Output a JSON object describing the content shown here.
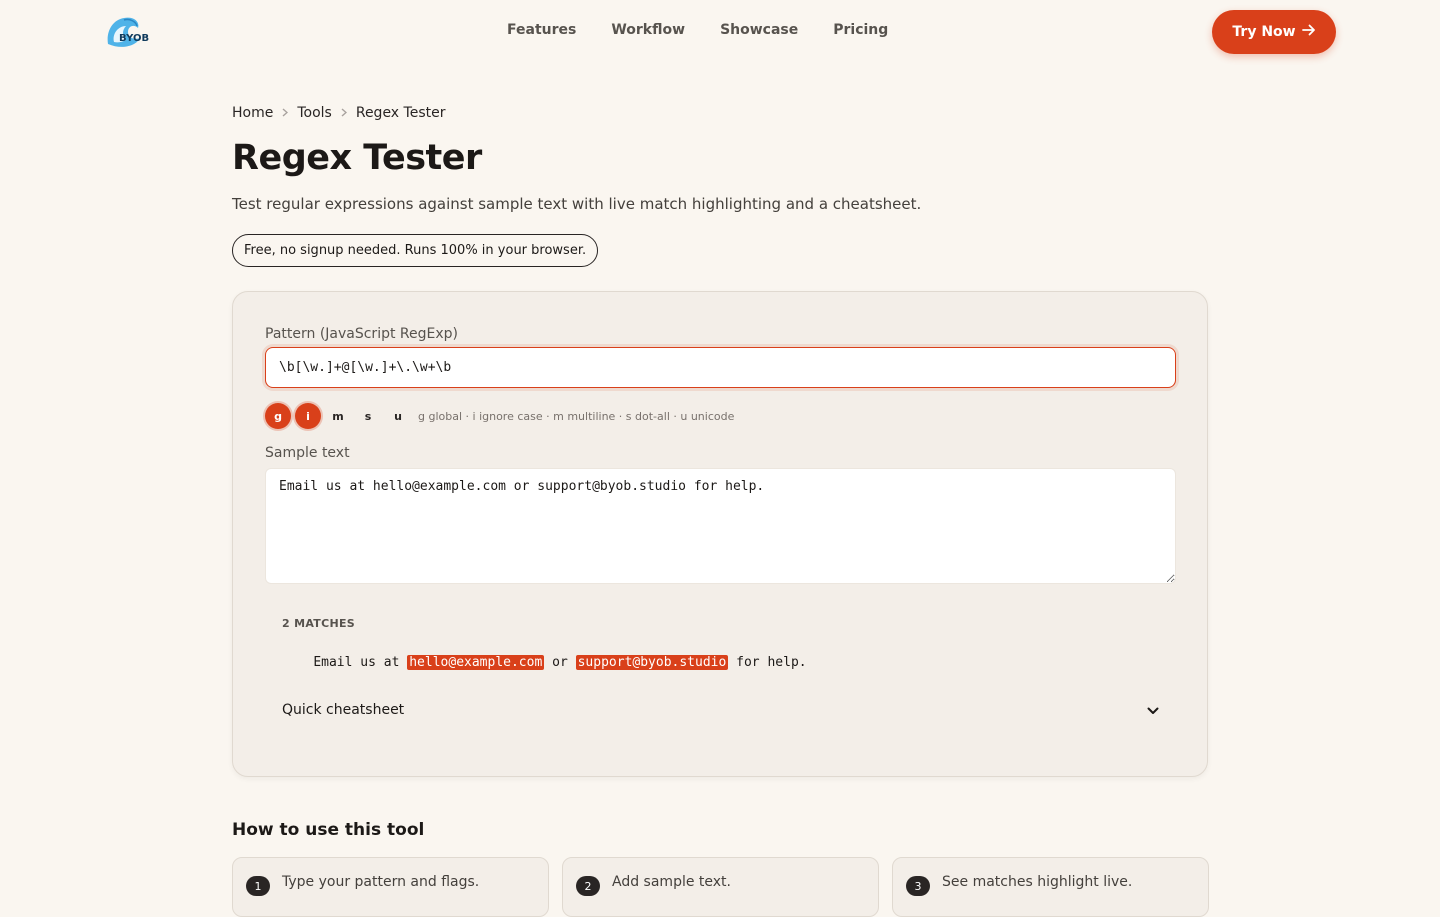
{
  "nav": {
    "logo_text": "BYOB",
    "links": [
      "Features",
      "Workflow",
      "Showcase",
      "Pricing"
    ],
    "cta_label": "Try Now"
  },
  "breadcrumb": [
    "Home",
    "Tools",
    "Regex Tester"
  ],
  "page": {
    "title": "Regex Tester",
    "subtitle": "Test regular expressions against sample text with live match highlighting and a cheatsheet.",
    "badge": "Free, no signup needed. Runs 100% in your browser."
  },
  "tool": {
    "pattern_label": "Pattern (JavaScript RegExp)",
    "pattern_value": "\\b[\\w.]+@[\\w.]+\\.\\w+\\b",
    "flags": [
      {
        "key": "g",
        "active": true
      },
      {
        "key": "i",
        "active": true
      },
      {
        "key": "m",
        "active": false
      },
      {
        "key": "s",
        "active": false
      },
      {
        "key": "u",
        "active": false
      }
    ],
    "flags_help": "g global · i ignore case · m multiline · s dot-all · u unicode",
    "sample_label": "Sample text",
    "sample_value": "Email us at hello@example.com or support@byob.studio for help.",
    "matches_count_label": "2 MATCHES",
    "match_segments": [
      {
        "text": "Email us at ",
        "match": false
      },
      {
        "text": "hello@example.com",
        "match": true
      },
      {
        "text": " or ",
        "match": false
      },
      {
        "text": "support@byob.studio",
        "match": true
      },
      {
        "text": " for help.",
        "match": false
      }
    ],
    "cheatsheet_label": "Quick cheatsheet"
  },
  "howto": {
    "title": "How to use this tool",
    "steps": [
      {
        "num": "1",
        "text": "Type your pattern and flags."
      },
      {
        "num": "2",
        "text": "Add sample text."
      },
      {
        "num": "3",
        "text": "See matches highlight live."
      }
    ]
  },
  "colors": {
    "accent": "#d9401a",
    "background": "#faf6f0",
    "card": "#f3eee8"
  }
}
